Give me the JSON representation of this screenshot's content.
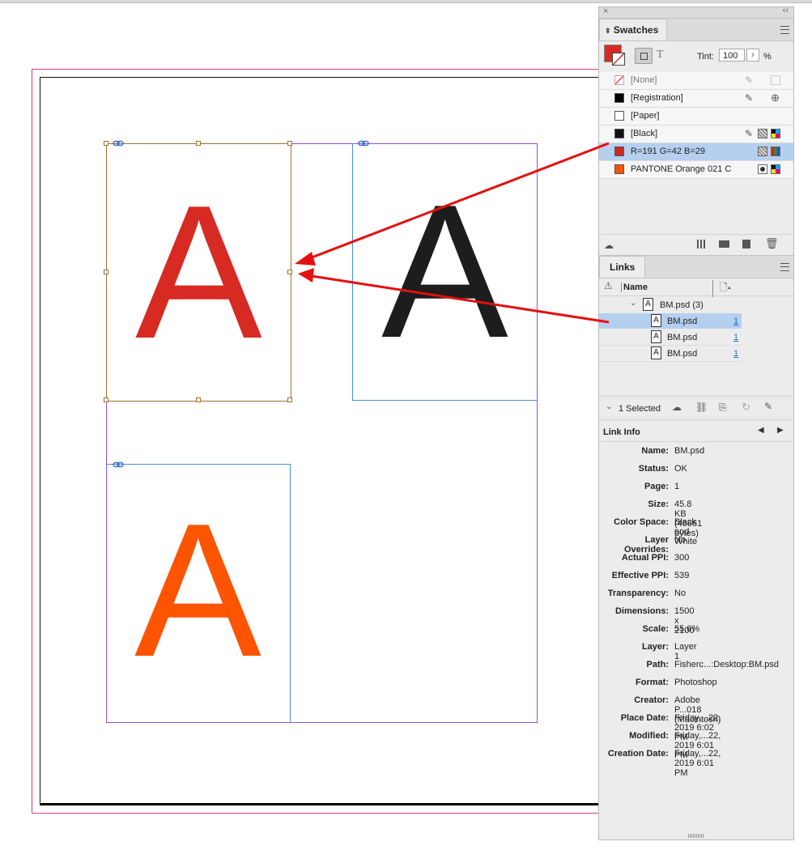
{
  "document": {
    "letters": {
      "red": "A",
      "black": "A",
      "orange": "A"
    },
    "colors": {
      "red": "#d72a23",
      "black": "#1d1d1d",
      "orange": "#fd5402",
      "arrow": "#e3110f"
    }
  },
  "swatches_panel": {
    "tab_label": "Swatches",
    "tint_label": "Tint:",
    "tint_value": "100",
    "tint_unit": "%",
    "fill_color": "#d72a23",
    "rows": [
      {
        "name": "[None]",
        "chip": "none"
      },
      {
        "name": "[Registration]",
        "chip": "#000000"
      },
      {
        "name": "[Paper]",
        "chip": "#ffffff"
      },
      {
        "name": "[Black]",
        "chip": "#111111"
      },
      {
        "name": "R=191 G=42 B=29",
        "chip": "#cc2a1d",
        "selected": true
      },
      {
        "name": "PANTONE Orange 021 C",
        "chip": "#fd5402"
      }
    ]
  },
  "links_panel": {
    "tab_label": "Links",
    "column_name": "Name",
    "group_name": "BM.psd (3)",
    "items": [
      {
        "name": "BM.psd",
        "page": "1",
        "selected": true
      },
      {
        "name": "BM.psd",
        "page": "1"
      },
      {
        "name": "BM.psd",
        "page": "1"
      }
    ],
    "selected_count": "1 Selected"
  },
  "link_info": {
    "title": "Link Info",
    "fields": [
      {
        "label": "Name:",
        "value": "BM.psd"
      },
      {
        "label": "Status:",
        "value": "OK"
      },
      {
        "label": "Page:",
        "value": "1"
      },
      {
        "label": "Size:",
        "value": "45.8 KB (46861 bytes)"
      },
      {
        "label": "Color Space:",
        "value": "Black and White"
      },
      {
        "label": "Layer Overrides:",
        "value": "No"
      },
      {
        "label": "Actual PPI:",
        "value": "300"
      },
      {
        "label": "Effective PPI:",
        "value": "539"
      },
      {
        "label": "Transparency:",
        "value": "No"
      },
      {
        "label": "Dimensions:",
        "value": "1500 x 2100"
      },
      {
        "label": "Scale:",
        "value": "55.6%"
      },
      {
        "label": "Layer:",
        "value": "Layer 1"
      },
      {
        "label": "Path:",
        "value": "Fisherc...:Desktop:BM.psd"
      },
      {
        "label": "Format:",
        "value": "Photoshop"
      },
      {
        "label": "Creator:",
        "value": "Adobe P...018 (Macintosh)"
      },
      {
        "label": "Place Date:",
        "value": "Friday,...22, 2019 6:02 PM"
      },
      {
        "label": "Modified:",
        "value": "Friday,...22, 2019 6:01 PM"
      },
      {
        "label": "Creation Date:",
        "value": "Friday,...22, 2019 6:01 PM"
      }
    ]
  }
}
